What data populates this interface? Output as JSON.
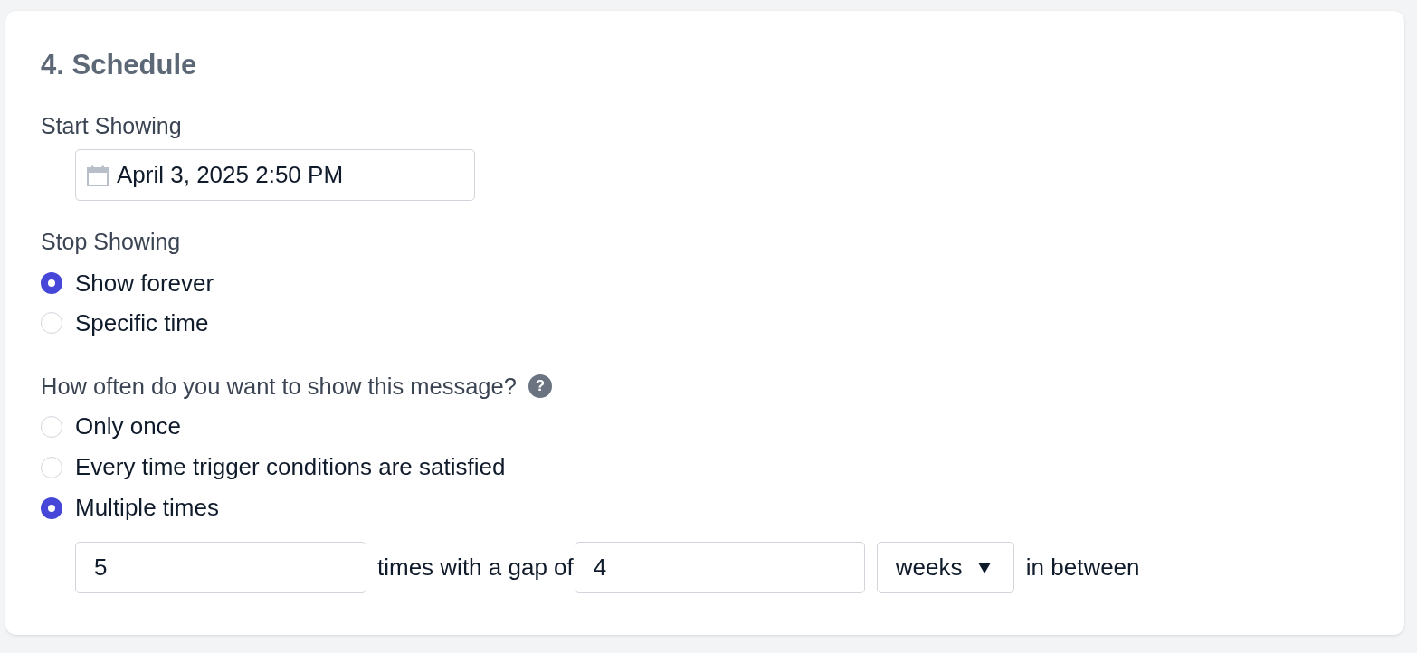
{
  "section": {
    "title": "4. Schedule"
  },
  "start_showing": {
    "label": "Start Showing",
    "value": "April 3, 2025 2:50 PM"
  },
  "stop_showing": {
    "label": "Stop Showing",
    "options": [
      {
        "label": "Show forever",
        "selected": true
      },
      {
        "label": "Specific time",
        "selected": false
      }
    ]
  },
  "frequency": {
    "question": "How often do you want to show this message?",
    "help": "?",
    "options": [
      {
        "label": "Only once",
        "selected": false
      },
      {
        "label": "Every time trigger conditions are satisfied",
        "selected": false
      },
      {
        "label": "Multiple times",
        "selected": true
      }
    ]
  },
  "repeat": {
    "count": "5",
    "text_before_gap": "times with a gap of",
    "gap": "4",
    "unit": "weeks",
    "text_after": "in between"
  }
}
